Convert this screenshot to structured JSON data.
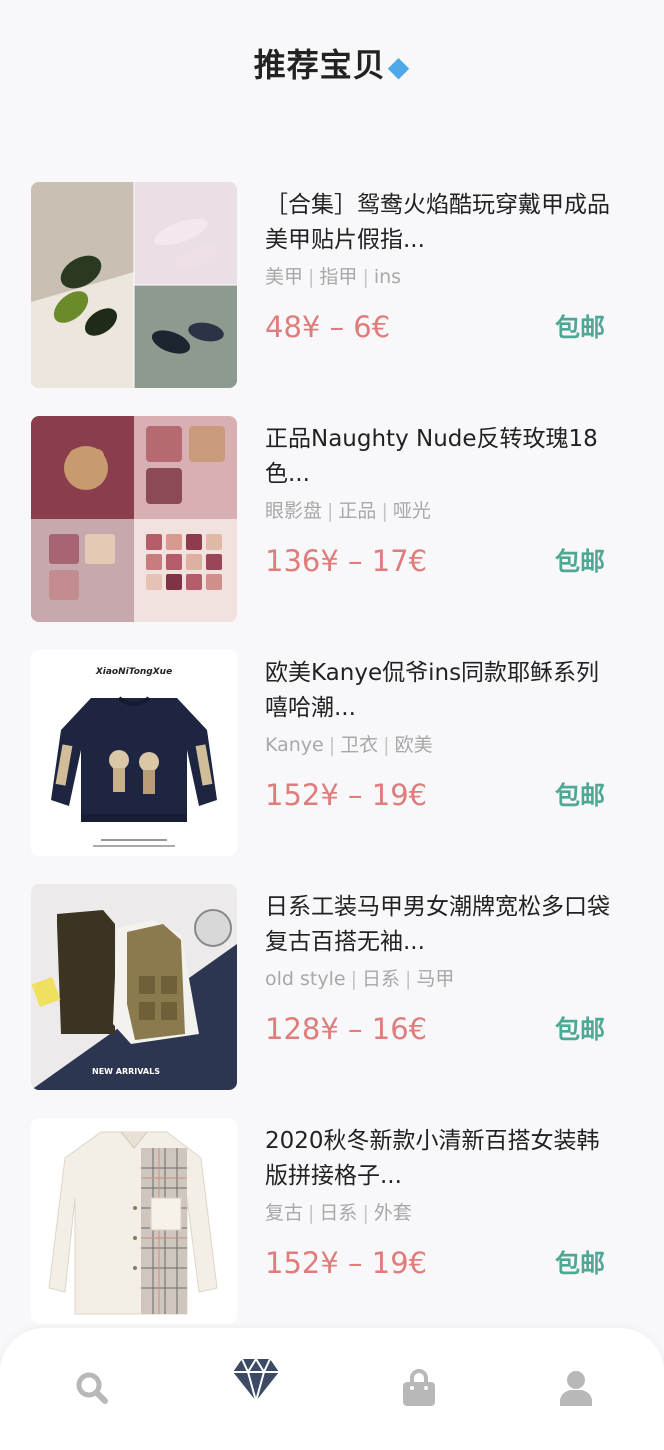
{
  "header": {
    "title": "推荐宝贝",
    "title_icon": "gem-icon"
  },
  "products": [
    {
      "title": "［合集］鸳鸯火焰酷玩穿戴甲成品美甲贴片假指...",
      "tags": [
        "美甲",
        "指甲",
        "ins"
      ],
      "price": "48¥ – 6€",
      "shipping": "包邮",
      "image": "nail-art-collage"
    },
    {
      "title": "正品Naughty Nude反转玫瑰18色...",
      "tags": [
        "眼影盘",
        "正品",
        "哑光"
      ],
      "price": "136¥ – 17€",
      "shipping": "包邮",
      "image": "eyeshadow-palette-collage"
    },
    {
      "title": "欧美Kanye侃爷ins同款耶稣系列嘻哈潮...",
      "tags": [
        "Kanye",
        "卫衣",
        "欧美"
      ],
      "price": "152¥ – 19€",
      "shipping": "包邮",
      "image": "navy-sweatshirt"
    },
    {
      "title": "日系工装马甲男女潮牌宽松多口袋复古百搭无袖...",
      "tags": [
        "old style",
        "日系",
        "马甲"
      ],
      "price": "128¥ – 16€",
      "shipping": "包邮",
      "image": "utility-vests"
    },
    {
      "title": "2020秋冬新款小清新百搭女装韩版拼接格子...",
      "tags": [
        "复古",
        "日系",
        "外套"
      ],
      "price": "152¥ – 19€",
      "shipping": "包邮",
      "image": "plaid-patchwork-shirt"
    }
  ],
  "image_text": {
    "sweatshirt_brand": "XiaoNiTongXue",
    "vest_banner": "NEW ARRIVALS"
  },
  "tabbar": [
    {
      "icon": "search-icon",
      "active": false
    },
    {
      "icon": "diamond-icon",
      "active": true
    },
    {
      "icon": "shopping-bag-icon",
      "active": false
    },
    {
      "icon": "user-icon",
      "active": false
    }
  ],
  "colors": {
    "price": "#e07c7c",
    "shipping": "#4fa894",
    "tag": "#a8a8a8",
    "tab_inactive": "#b8b8b8",
    "tab_active": "#3d4a66"
  }
}
